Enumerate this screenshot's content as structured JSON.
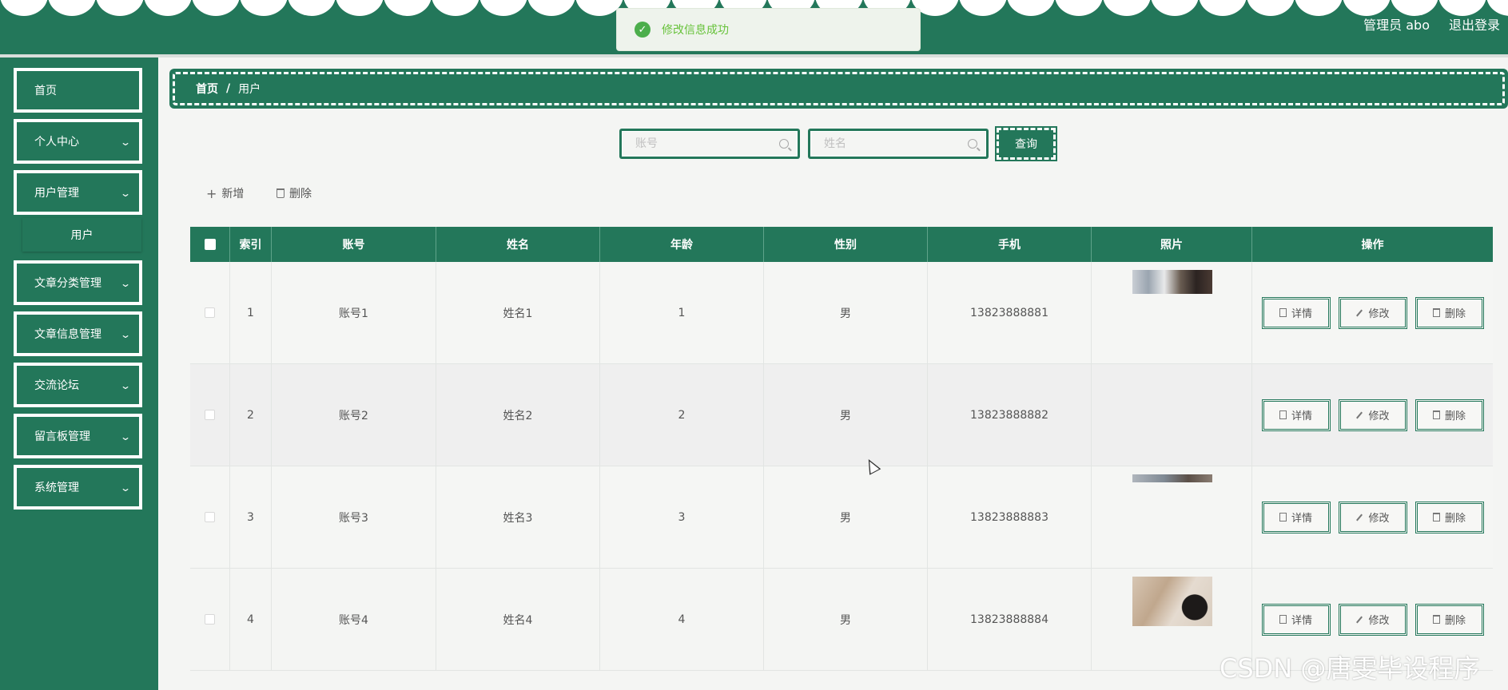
{
  "header": {
    "user_label": "管理员 abo",
    "logout_label": "退出登录"
  },
  "toast": {
    "icon": "check-circle-icon",
    "message": "修改信息成功"
  },
  "sidebar": {
    "items": [
      {
        "label": "首页",
        "has_children": false
      },
      {
        "label": "个人中心",
        "has_children": true
      },
      {
        "label": "用户管理",
        "has_children": true,
        "expanded": true,
        "children": [
          {
            "label": "用户"
          }
        ]
      },
      {
        "label": "文章分类管理",
        "has_children": true
      },
      {
        "label": "文章信息管理",
        "has_children": true
      },
      {
        "label": "交流论坛",
        "has_children": true
      },
      {
        "label": "留言板管理",
        "has_children": true
      },
      {
        "label": "系统管理",
        "has_children": true
      }
    ]
  },
  "breadcrumb": {
    "home": "首页",
    "separator": "/",
    "current": "用户"
  },
  "search": {
    "account_placeholder": "账号",
    "name_placeholder": "姓名",
    "button_label": "查询"
  },
  "actions": {
    "add_label": "新增",
    "delete_label": "删除"
  },
  "table": {
    "columns": [
      "索引",
      "账号",
      "姓名",
      "年龄",
      "性别",
      "手机",
      "照片",
      "操作"
    ],
    "rows": [
      {
        "index": "1",
        "account": "账号1",
        "name": "姓名1",
        "age": "1",
        "gender": "男",
        "phone": "13823888881",
        "photo": "photo-thumbnail"
      },
      {
        "index": "2",
        "account": "账号2",
        "name": "姓名2",
        "age": "2",
        "gender": "男",
        "phone": "13823888882",
        "photo": ""
      },
      {
        "index": "3",
        "account": "账号3",
        "name": "姓名3",
        "age": "3",
        "gender": "男",
        "phone": "13823888883",
        "photo": "photo-thumbnail"
      },
      {
        "index": "4",
        "account": "账号4",
        "name": "姓名4",
        "age": "4",
        "gender": "男",
        "phone": "13823888884",
        "photo": "photo-thumbnail"
      }
    ],
    "row_actions": {
      "detail": "详情",
      "edit": "修改",
      "delete": "删除"
    }
  },
  "watermark": "CSDN @唐雯毕设程序",
  "colors": {
    "primary": "#23775a",
    "background": "#f4f5f3",
    "toast_text": "#67c23a"
  }
}
